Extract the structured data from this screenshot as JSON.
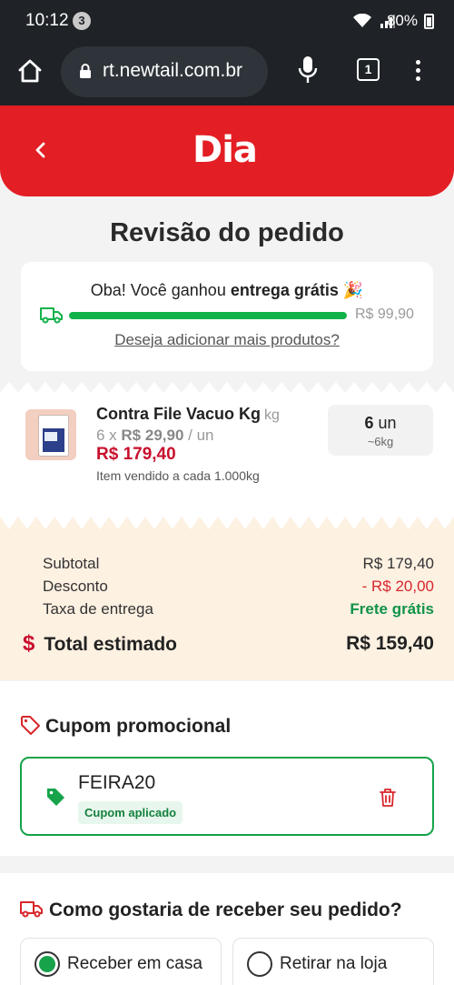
{
  "status_bar": {
    "time": "10:12",
    "notification_count": "3",
    "battery": "80%"
  },
  "browser": {
    "url": "rt.newtail.com.br",
    "tab_count": "1"
  },
  "header": {
    "logo": "Dia"
  },
  "page": {
    "title": "Revisão do pedido"
  },
  "shipping_banner": {
    "message_prefix": "Oba! Você ganhou ",
    "message_bold": "entrega grátis",
    "message_emoji": " 🎉",
    "progress": 1.0,
    "threshold": "R$ 99,90",
    "add_more_link": "Deseja adicionar mais produtos?"
  },
  "product": {
    "name": "Contra File Vacuo Kg",
    "unit": "kg",
    "qty_prefix": "6 x ",
    "unit_price": "R$ 29,90",
    "unit_suffix": " / un",
    "total": "R$ 179,40",
    "note": "Item vendido a cada 1.000kg",
    "quantity": "6",
    "quantity_unit": " un",
    "weight": "~6kg"
  },
  "totals": {
    "subtotal_label": "Subtotal",
    "subtotal_value": "R$ 179,40",
    "discount_label": "Desconto",
    "discount_value": "- R$ 20,00",
    "delivery_label": "Taxa de entrega",
    "delivery_value": "Frete grátis",
    "total_symbol": "$",
    "total_label": "Total estimado",
    "total_value": "R$ 159,40"
  },
  "coupon": {
    "section_title": "Cupom promocional",
    "code": "FEIRA20",
    "status": "Cupom aplicado"
  },
  "delivery": {
    "section_title": "Como gostaria de receber seu pedido?",
    "options": [
      {
        "label": "Receber em casa",
        "selected": true
      },
      {
        "label": "Retirar na loja",
        "selected": false
      }
    ]
  },
  "colors": {
    "brand_red": "#e31e24",
    "success_green": "#12b24b",
    "price_red": "#c8102e"
  }
}
